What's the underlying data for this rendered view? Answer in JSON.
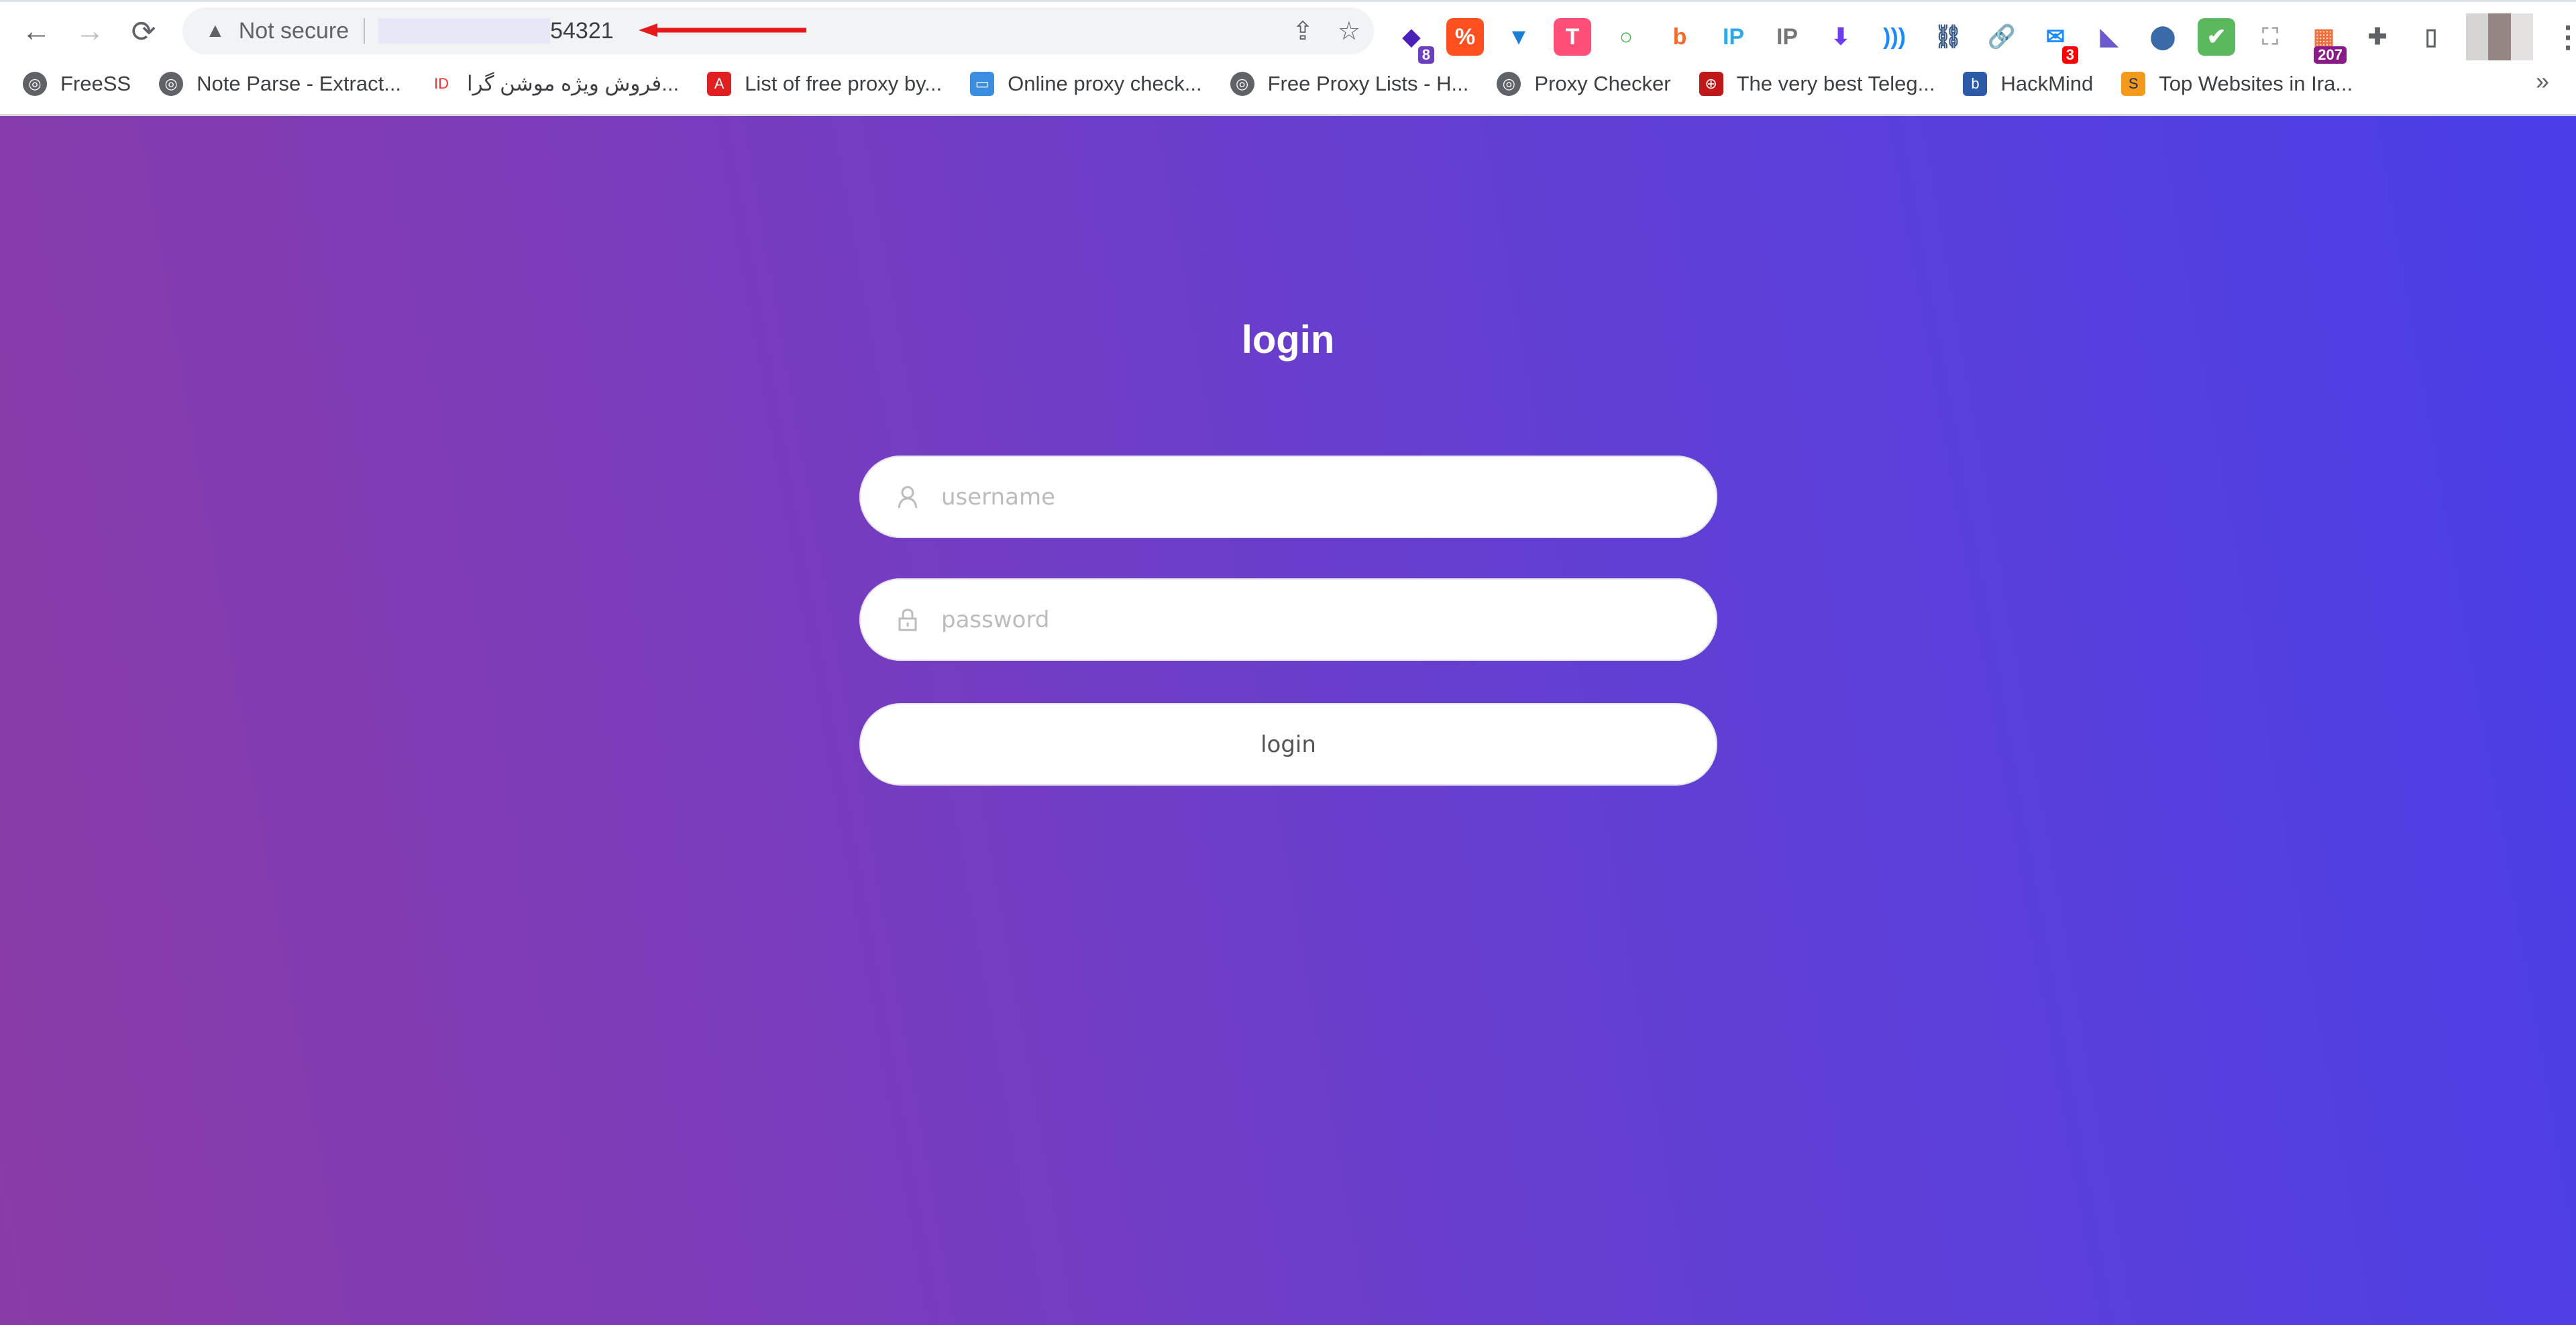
{
  "browser": {
    "nav": {
      "back": "←",
      "forward": "→",
      "reload": "⟳"
    },
    "address": {
      "security_label": "Not secure",
      "url_visible": "54321"
    },
    "omnibox_icons": {
      "share": "⇪",
      "star": "☆"
    },
    "extensions": [
      {
        "name": "stack-extension-icon",
        "glyph": "◆",
        "color": "#4b20b8",
        "bg": "transparent",
        "badge": "8",
        "badge_bg": "#6b3fc0"
      },
      {
        "name": "code-extension-icon",
        "glyph": "%",
        "color": "#fff",
        "bg": "#ff4f1f"
      },
      {
        "name": "funnel-extension-icon",
        "glyph": "▼",
        "color": "#1a7fd4",
        "bg": "transparent"
      },
      {
        "name": "t-extension-icon",
        "glyph": "T",
        "color": "#fff",
        "bg": "#ff4f78"
      },
      {
        "name": "ring-extension-icon",
        "glyph": "○",
        "color": "#4caf50",
        "bg": "transparent"
      },
      {
        "name": "b-extension-icon",
        "glyph": "b",
        "color": "#f36a2a",
        "bg": "transparent"
      },
      {
        "name": "ip-bubble-extension-icon",
        "glyph": "IP",
        "color": "#2fa8e6",
        "bg": "transparent"
      },
      {
        "name": "ip-search-extension-icon",
        "glyph": "IP",
        "color": "#777",
        "bg": "transparent"
      },
      {
        "name": "download-extension-icon",
        "glyph": "⬇",
        "color": "#6a3df0",
        "bg": "transparent"
      },
      {
        "name": "wave-extension-icon",
        "glyph": ")))",
        "color": "#1a8cff",
        "bg": "transparent"
      },
      {
        "name": "chain-globe-extension-icon",
        "glyph": "⛓",
        "color": "#3a5a8a",
        "bg": "transparent"
      },
      {
        "name": "link-extension-icon",
        "glyph": "🔗",
        "color": "#2a7de1",
        "bg": "transparent"
      },
      {
        "name": "mail-extension-icon",
        "glyph": "✉",
        "color": "#1a8cff",
        "bg": "transparent",
        "badge": "3",
        "badge_bg": "#ff0000"
      },
      {
        "name": "tron-extension-icon",
        "glyph": "◣",
        "color": "#6a5acd",
        "bg": "transparent"
      },
      {
        "name": "location-pin-extension-icon",
        "glyph": "⬤",
        "color": "#3b6aa8",
        "bg": "transparent"
      },
      {
        "name": "shield-extension-icon",
        "glyph": "✔",
        "color": "#fff",
        "bg": "#5cb85c"
      },
      {
        "name": "screenshot-extension-icon",
        "glyph": "⛶",
        "color": "#aaa",
        "bg": "transparent"
      },
      {
        "name": "calendar-extension-icon",
        "glyph": "▦",
        "color": "#f07040",
        "bg": "transparent",
        "badge": "207",
        "badge_bg": "#8a1a8a"
      },
      {
        "name": "puzzle-extensions-icon",
        "glyph": "✚",
        "color": "#5f6368",
        "bg": "transparent"
      },
      {
        "name": "side-panel-icon",
        "glyph": "▯",
        "color": "#5f6368",
        "bg": "transparent"
      }
    ],
    "menu_icon": "⋮",
    "bookmarks": [
      {
        "label": "FreeSS",
        "icon": "globe"
      },
      {
        "label": "Note Parse - Extract...",
        "icon": "globe"
      },
      {
        "label": "فروش ویژه موشن گرا...",
        "icon": "ID"
      },
      {
        "label": "List of free proxy by...",
        "icon": "A"
      },
      {
        "label": "Online proxy check...",
        "icon": "monitor"
      },
      {
        "label": "Free Proxy Lists - H...",
        "icon": "globe"
      },
      {
        "label": "Proxy Checker",
        "icon": "globe"
      },
      {
        "label": "The very best Teleg...",
        "icon": "Q"
      },
      {
        "label": "HackMind",
        "icon": "b"
      },
      {
        "label": "Top Websites in Ira...",
        "icon": "S"
      }
    ],
    "bookmarks_overflow": "»"
  },
  "page": {
    "title": "login",
    "username": {
      "placeholder": "username",
      "value": ""
    },
    "password": {
      "placeholder": "password",
      "value": ""
    },
    "submit_label": "login",
    "colors": {
      "gradient_start": "#8a3ca6",
      "gradient_end": "#4a3fe8"
    }
  }
}
